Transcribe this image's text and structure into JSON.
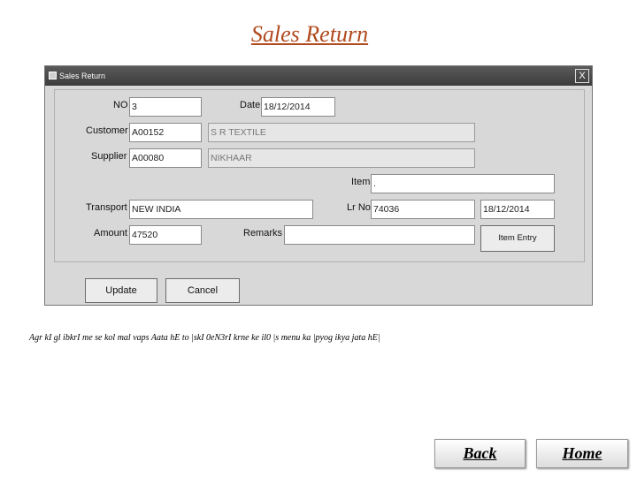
{
  "page": {
    "title": "Sales Return"
  },
  "window": {
    "title": "Sales Return",
    "close_label": "X"
  },
  "form": {
    "no": {
      "label": "NO",
      "value": "3"
    },
    "date": {
      "label": "Date",
      "value": "18/12/2014"
    },
    "customer": {
      "label": "Customer",
      "code": "A00152",
      "name": "S R TEXTILE"
    },
    "supplier": {
      "label": "Supplier",
      "code": "A00080",
      "name": "NIKHAAR"
    },
    "item": {
      "label": "Item",
      "value": "."
    },
    "transport": {
      "label": "Transport",
      "value": "NEW INDIA"
    },
    "lr_no": {
      "label": "Lr No",
      "value": "74036",
      "date": "18/12/2014"
    },
    "amount": {
      "label": "Amount",
      "value": "47520"
    },
    "remarks": {
      "label": "Remarks",
      "value": ""
    },
    "item_entry_label": "Item Entry",
    "update_label": "Update",
    "cancel_label": "Cancel"
  },
  "description": "Agr kI gl ibkrI me se kol mal vaps Aata hE to |skI 0eN3rI krne ke il0 |s menu ka |pyog ikya jata hE|",
  "nav": {
    "back_label": "Back",
    "home_label": "Home"
  }
}
